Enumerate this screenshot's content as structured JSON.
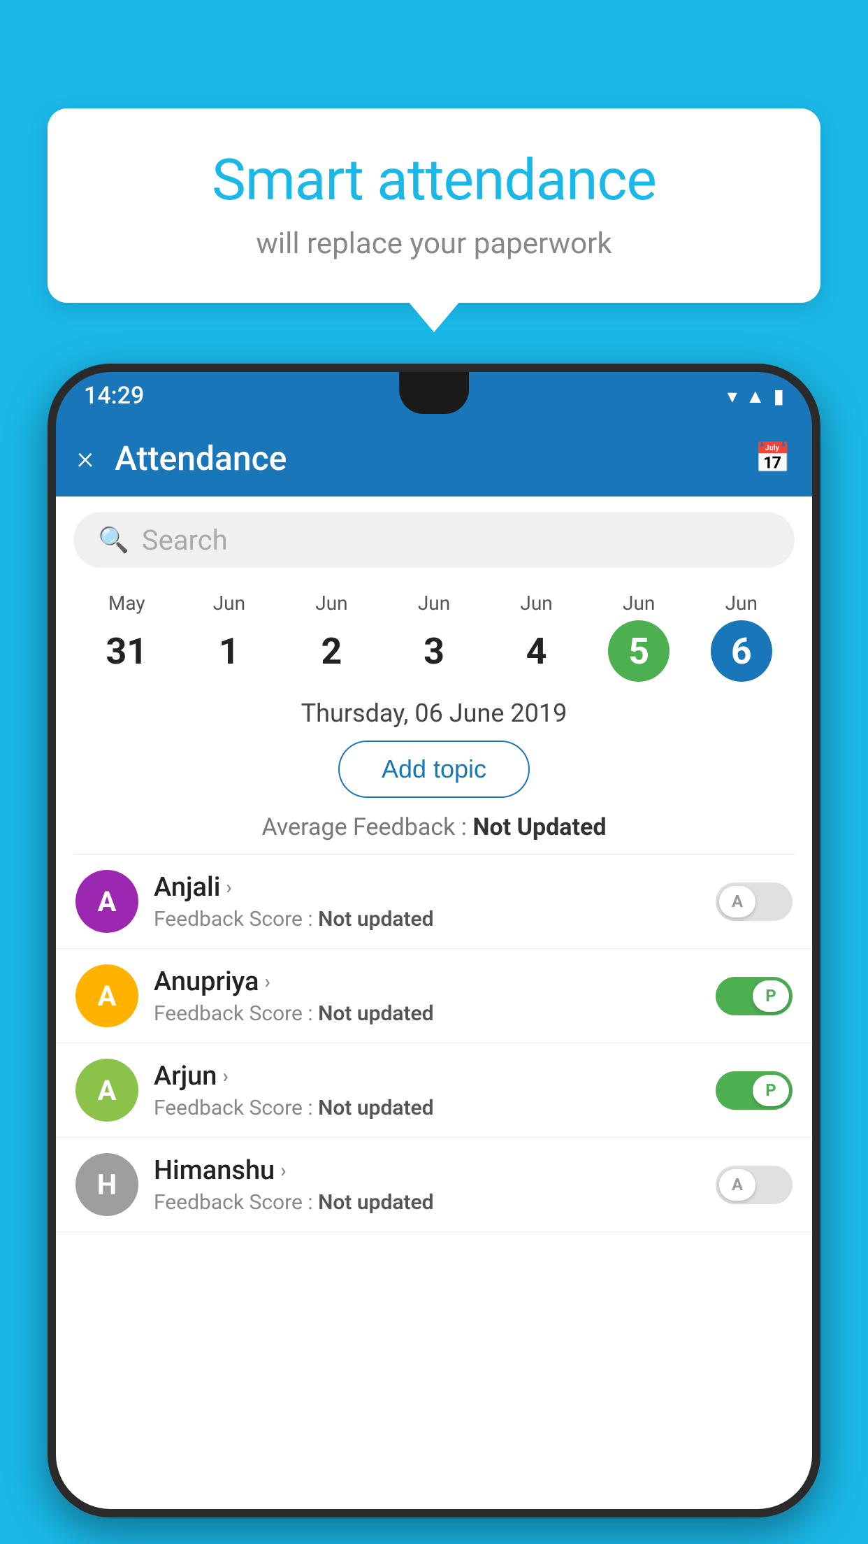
{
  "background_color": "#1ab8e8",
  "speech_bubble": {
    "title": "Smart attendance",
    "subtitle": "will replace your paperwork"
  },
  "status_bar": {
    "time": "14:29",
    "icons": [
      "wifi",
      "signal",
      "battery"
    ]
  },
  "app_bar": {
    "close_label": "×",
    "title": "Attendance",
    "calendar_icon": "📅"
  },
  "search": {
    "placeholder": "Search"
  },
  "dates": [
    {
      "month": "May",
      "day": "31",
      "style": "normal"
    },
    {
      "month": "Jun",
      "day": "1",
      "style": "normal"
    },
    {
      "month": "Jun",
      "day": "2",
      "style": "normal"
    },
    {
      "month": "Jun",
      "day": "3",
      "style": "normal"
    },
    {
      "month": "Jun",
      "day": "4",
      "style": "normal"
    },
    {
      "month": "Jun",
      "day": "5",
      "style": "today"
    },
    {
      "month": "Jun",
      "day": "6",
      "style": "selected"
    }
  ],
  "selected_date_label": "Thursday, 06 June 2019",
  "add_topic_label": "Add topic",
  "average_feedback_label": "Average Feedback : ",
  "average_feedback_value": "Not Updated",
  "students": [
    {
      "name": "Anjali",
      "avatar_letter": "A",
      "avatar_color": "#9c27b0",
      "feedback_label": "Feedback Score : ",
      "feedback_value": "Not updated",
      "toggle": "off",
      "toggle_label": "A"
    },
    {
      "name": "Anupriya",
      "avatar_letter": "A",
      "avatar_color": "#ffb300",
      "feedback_label": "Feedback Score : ",
      "feedback_value": "Not updated",
      "toggle": "on",
      "toggle_label": "P"
    },
    {
      "name": "Arjun",
      "avatar_letter": "A",
      "avatar_color": "#8bc34a",
      "feedback_label": "Feedback Score : ",
      "feedback_value": "Not updated",
      "toggle": "on",
      "toggle_label": "P"
    },
    {
      "name": "Himanshu",
      "avatar_letter": "H",
      "avatar_color": "#9e9e9e",
      "feedback_label": "Feedback Score : ",
      "feedback_value": "Not updated",
      "toggle": "off",
      "toggle_label": "A"
    }
  ]
}
